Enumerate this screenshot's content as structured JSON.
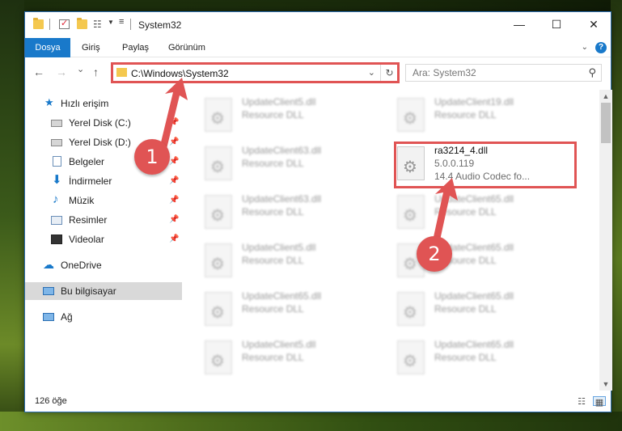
{
  "window": {
    "title": "System32",
    "controls": {
      "minimize": "—",
      "maximize": "☐",
      "close": "✕"
    }
  },
  "ribbon": {
    "tabs": [
      "Dosya",
      "Giriş",
      "Paylaş",
      "Görünüm"
    ],
    "help": "?"
  },
  "nav": {
    "back": "←",
    "forward": "→",
    "recent": "⌄",
    "up": "↑",
    "address": "C:\\Windows\\System32",
    "refresh": "↻",
    "dropdown": "⌄"
  },
  "search": {
    "placeholder": "Ara: System32",
    "icon": "search-icon"
  },
  "sidebar": {
    "quick_access": "Hızlı erişim",
    "items": [
      {
        "label": "Yerel Disk (C:)",
        "icon": "drive-icon",
        "pinned": true
      },
      {
        "label": "Yerel Disk (D:)",
        "icon": "drive-icon",
        "pinned": true
      },
      {
        "label": "Belgeler",
        "icon": "documents-icon",
        "pinned": true
      },
      {
        "label": "İndirmeler",
        "icon": "download-icon",
        "pinned": true
      },
      {
        "label": "Müzik",
        "icon": "music-icon",
        "pinned": true
      },
      {
        "label": "Resimler",
        "icon": "pictures-icon",
        "pinned": true
      },
      {
        "label": "Videolar",
        "icon": "videos-icon",
        "pinned": true
      }
    ],
    "onedrive": "OneDrive",
    "this_pc": "Bu bilgisayar",
    "network": "Ağ"
  },
  "files": {
    "left": [
      {
        "name": "UpdateClient5.dll",
        "desc": "Resource DLL"
      },
      {
        "name": "UpdateClient63.dll",
        "desc": "Resource DLL"
      },
      {
        "name": "UpdateClient63.dll",
        "desc": "Resource DLL"
      },
      {
        "name": "UpdateClient5.dll",
        "desc": "Resource DLL"
      },
      {
        "name": "UpdateClient65.dll",
        "desc": "Resource DLL"
      },
      {
        "name": "UpdateClient5.dll",
        "desc": "Resource DLL"
      }
    ],
    "right": [
      {
        "name": "UpdateClient19.dll",
        "desc": "Resource DLL"
      },
      {
        "name": "UpdateClient65.dll",
        "desc": "Resource DLL"
      },
      {
        "name": "UpdateClient65.dll",
        "desc": "Resource DLL"
      },
      {
        "name": "UpdateClient65.dll",
        "desc": "Resource DLL"
      },
      {
        "name": "UpdateClient65.dll",
        "desc": "Resource DLL"
      }
    ],
    "highlighted": {
      "name": "ra3214_4.dll",
      "version": "5.0.0.119",
      "desc": "14.4 Audio Codec fo..."
    }
  },
  "status": {
    "count": "126 öğe"
  },
  "annotations": {
    "step1": "1",
    "step2": "2",
    "color": "#e05454"
  }
}
